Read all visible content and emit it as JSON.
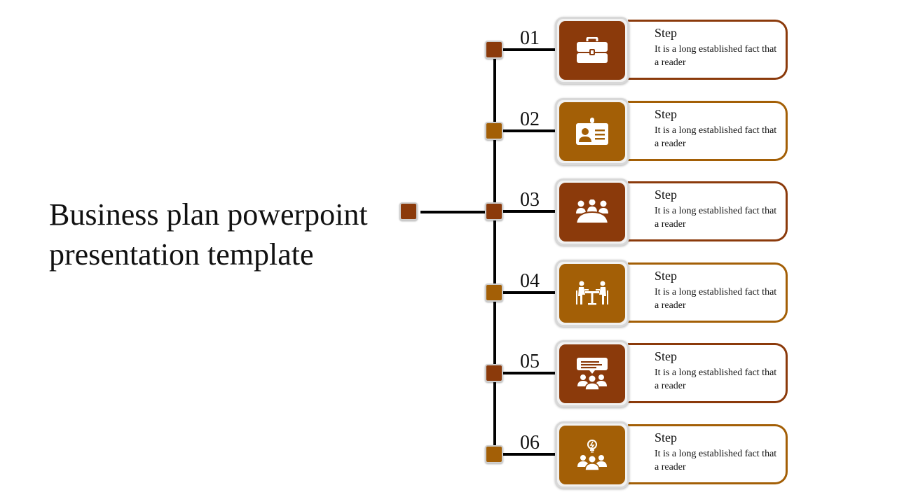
{
  "slide": {
    "title": "Business plan powerpoint presentation template",
    "colors": {
      "dark": "#8B3A0B",
      "light": "#A35F06",
      "line": "#000000"
    },
    "steps": [
      {
        "number": "01",
        "title": "Step",
        "description": "It is a long established fact that a reader",
        "icon": "briefcase-icon",
        "color": "#8B3A0B"
      },
      {
        "number": "02",
        "title": "Step",
        "description": "It is a long established fact that a reader",
        "icon": "id-badge-icon",
        "color": "#A35F06"
      },
      {
        "number": "03",
        "title": "Step",
        "description": "It is a long established fact that a reader",
        "icon": "meeting-table-icon",
        "color": "#8B3A0B"
      },
      {
        "number": "04",
        "title": "Step",
        "description": "It is a long established fact that a reader",
        "icon": "interview-icon",
        "color": "#A35F06"
      },
      {
        "number": "05",
        "title": "Step",
        "description": "It is a long established fact that a reader",
        "icon": "presentation-group-icon",
        "color": "#8B3A0B"
      },
      {
        "number": "06",
        "title": "Step",
        "description": "It is a long established fact that a reader",
        "icon": "idea-team-icon",
        "color": "#A35F06"
      }
    ]
  }
}
